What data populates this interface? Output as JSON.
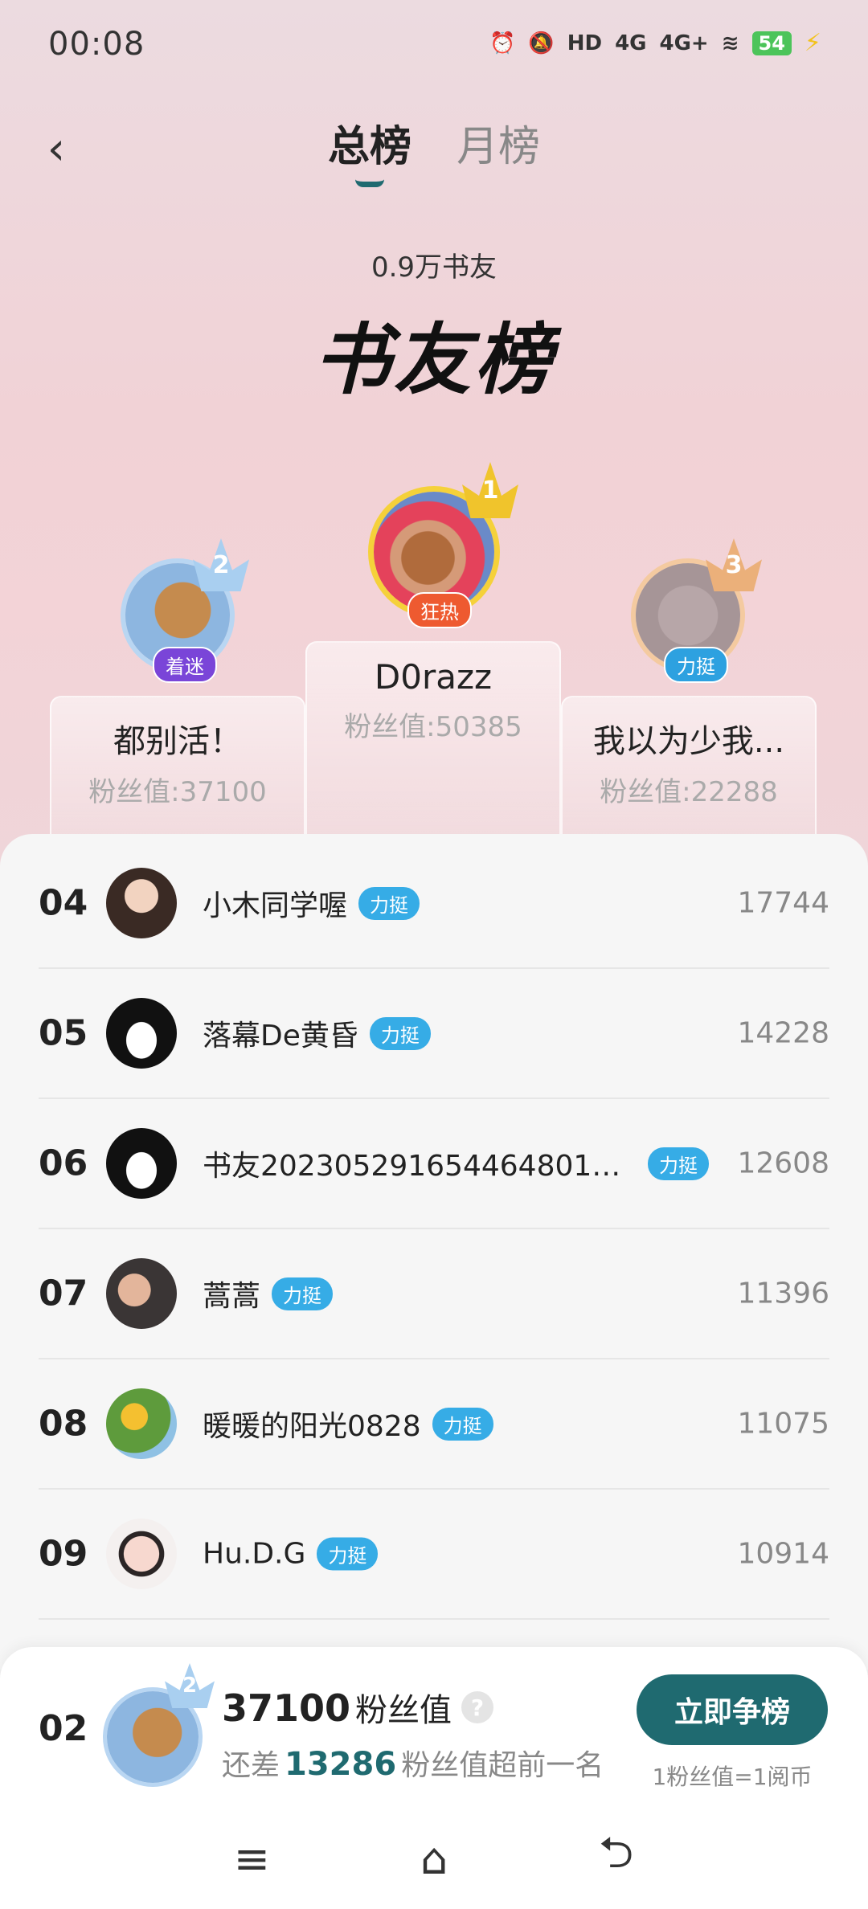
{
  "status": {
    "time": "00:08",
    "battery": "54",
    "network1": "4G",
    "network2": "4G+",
    "hd": "HD"
  },
  "header": {
    "back_icon": "chevron-left-icon",
    "tabs": [
      {
        "label": "总榜",
        "active": true
      },
      {
        "label": "月榜",
        "active": false
      }
    ]
  },
  "summary": {
    "count": "0.9万书友",
    "title": "书友榜"
  },
  "podium": {
    "first": {
      "rank": "1",
      "name": "D0razz",
      "fans": "粉丝值:50385",
      "badge": "狂热"
    },
    "second": {
      "rank": "2",
      "name": "都别活！",
      "fans": "粉丝值:37100",
      "badge": "着迷"
    },
    "third": {
      "rank": "3",
      "name": "我以为少我...",
      "fans": "粉丝值:22288",
      "badge": "力挺"
    }
  },
  "list": [
    {
      "rank": "04",
      "name": "小木同学喔",
      "tag": "力挺",
      "score": "17744"
    },
    {
      "rank": "05",
      "name": "落幕De黄昏",
      "tag": "力挺",
      "score": "14228"
    },
    {
      "rank": "06",
      "name": "书友20230529165446480199...",
      "tag": "力挺",
      "score": "12608"
    },
    {
      "rank": "07",
      "name": "蒿蒿",
      "tag": "力挺",
      "score": "11396"
    },
    {
      "rank": "08",
      "name": "暖暖的阳光0828",
      "tag": "力挺",
      "score": "11075"
    },
    {
      "rank": "09",
      "name": "Hu.D.G",
      "tag": "力挺",
      "score": "10914"
    }
  ],
  "me": {
    "rank": "02",
    "crown_rank": "2",
    "fans": "37100",
    "fans_unit": "粉丝值",
    "help": "?",
    "diff_prefix": "还差",
    "diff": "13286",
    "diff_suffix": "粉丝值超前一名",
    "button": "立即争榜",
    "note": "1粉丝值=1阅币"
  },
  "nav": {
    "menu": "≡",
    "home": "⌂",
    "back": "⮌"
  },
  "colors": {
    "accent": "#1f6a70",
    "tag": "#36ace6"
  }
}
